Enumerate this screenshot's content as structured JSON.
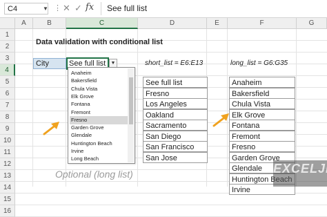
{
  "formula_bar": {
    "name_box": "C4",
    "x_symbol": "✕",
    "check_symbol": "✓",
    "fx_symbol": "fx",
    "content": "See full list"
  },
  "columns": [
    "A",
    "B",
    "C",
    "D",
    "E",
    "F",
    "G"
  ],
  "rows": [
    "1",
    "2",
    "3",
    "4",
    "5",
    "6",
    "7",
    "8",
    "9",
    "10",
    "11",
    "12",
    "13",
    "14",
    "15",
    "16"
  ],
  "title": "Data validation with conditional list",
  "city_label": "City",
  "active_cell_value": "See full list",
  "short_list_label": "short_list = E6:E13",
  "long_list_label": "long_list = G6:G35",
  "dropdown_items": [
    "Anaheim",
    "Bakersfield",
    "Chula Vista",
    "Elk Grove",
    "Fontana",
    "Fremont",
    "Fresno",
    "Garden Grove",
    "Glendale",
    "Huntington Beach",
    "Irvine",
    "Long Beach"
  ],
  "dropdown_highlighted": "Fresno",
  "short_list": [
    "See full list",
    "Fresno",
    "Los Angeles",
    "Oakland",
    "Sacramento",
    "San Diego",
    "San Francisco",
    "San Jose"
  ],
  "long_list": [
    "Anaheim",
    "Bakersfield",
    "Chula Vista",
    "Elk Grove",
    "Fontana",
    "Fremont",
    "Fresno",
    "Garden Grove",
    "Glendale",
    "Huntington Beach",
    "Irvine"
  ],
  "optional_note": "Optional (long list)",
  "watermark": "EXCELJET",
  "colors": {
    "accent_green": "#217346",
    "arrow": "#f0a21f",
    "label_fill": "#d6e4f0"
  }
}
